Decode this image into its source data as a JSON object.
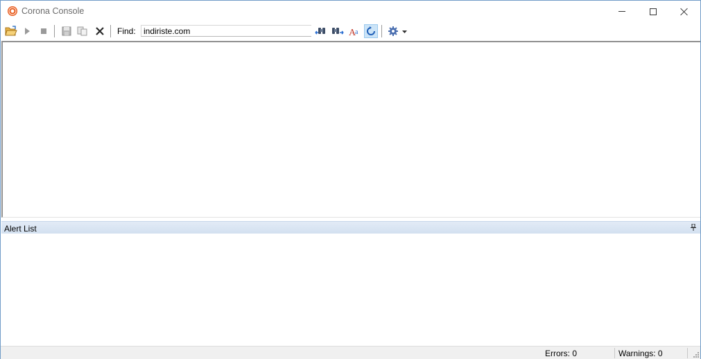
{
  "window": {
    "title": "Corona Console"
  },
  "toolbar": {
    "find_label": "Find:",
    "find_value": "indiriste.com",
    "buttons": [
      {
        "name": "open-icon"
      },
      {
        "name": "play-icon"
      },
      {
        "name": "stop-icon"
      },
      {
        "name": "save-icon"
      },
      {
        "name": "copy-icon"
      },
      {
        "name": "clear-icon"
      },
      {
        "name": "find-previous-icon"
      },
      {
        "name": "find-next-icon"
      },
      {
        "name": "match-case-icon"
      },
      {
        "name": "wrap-around-icon",
        "active": true
      },
      {
        "name": "settings-gear-icon"
      }
    ]
  },
  "alert_list": {
    "title": "Alert List"
  },
  "status": {
    "errors": "Errors: 0",
    "warnings": "Warnings: 0"
  },
  "colors": {
    "accent_orange": "#e8591a",
    "panel_header": "#d9e4f2",
    "active_button": "#cce4f7"
  }
}
